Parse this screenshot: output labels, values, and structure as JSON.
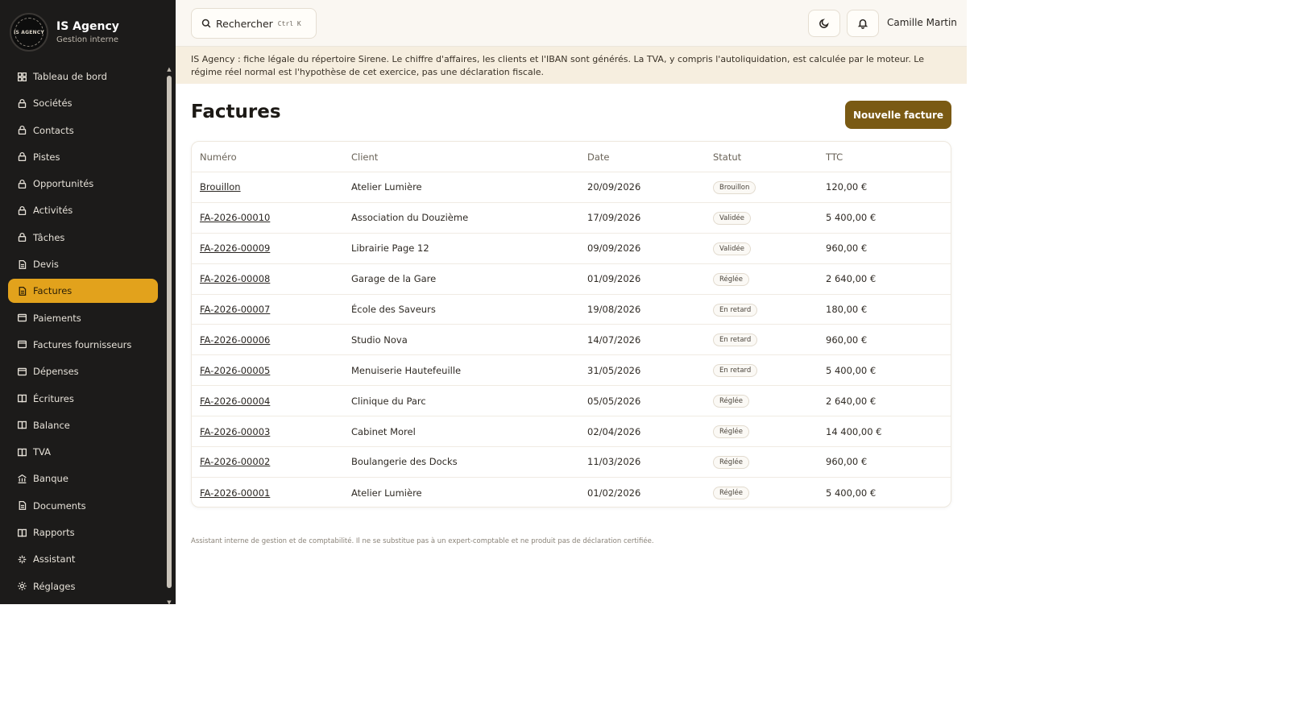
{
  "brand": {
    "logo_text": "IS AGENCY",
    "name": "IS Agency",
    "subtitle": "Gestion interne"
  },
  "sidebar": {
    "items": [
      {
        "label": "Tableau de bord",
        "icon": "dashboard-icon",
        "active": false
      },
      {
        "label": "Sociétés",
        "icon": "lock-icon",
        "active": false
      },
      {
        "label": "Contacts",
        "icon": "lock-icon",
        "active": false
      },
      {
        "label": "Pistes",
        "icon": "lock-icon",
        "active": false
      },
      {
        "label": "Opportunités",
        "icon": "lock-icon",
        "active": false
      },
      {
        "label": "Activités",
        "icon": "lock-icon",
        "active": false
      },
      {
        "label": "Tâches",
        "icon": "lock-icon",
        "active": false
      },
      {
        "label": "Devis",
        "icon": "file-icon",
        "active": false
      },
      {
        "label": "Factures",
        "icon": "file-icon",
        "active": true
      },
      {
        "label": "Paiements",
        "icon": "card-icon",
        "active": false
      },
      {
        "label": "Factures fournisseurs",
        "icon": "card-icon",
        "active": false
      },
      {
        "label": "Dépenses",
        "icon": "card-icon",
        "active": false
      },
      {
        "label": "Écritures",
        "icon": "book-icon",
        "active": false
      },
      {
        "label": "Balance",
        "icon": "book-icon",
        "active": false
      },
      {
        "label": "TVA",
        "icon": "book-icon",
        "active": false
      },
      {
        "label": "Banque",
        "icon": "bank-icon",
        "active": false
      },
      {
        "label": "Documents",
        "icon": "file-icon",
        "active": false
      },
      {
        "label": "Rapports",
        "icon": "book-icon",
        "active": false
      },
      {
        "label": "Assistant",
        "icon": "sparkle-icon",
        "active": false
      },
      {
        "label": "Réglages",
        "icon": "gear-icon",
        "active": false
      }
    ]
  },
  "topbar": {
    "search_label": "Rechercher",
    "search_shortcut": "Ctrl K",
    "user_name": "Camille Martin"
  },
  "banner": {
    "text": "IS Agency : fiche légale du répertoire Sirene. Le chiffre d'affaires, les clients et l'IBAN sont générés. La TVA, y compris l'autoliquidation, est calculée par le moteur. Le régime réel normal est l'hypothèse de cet exercice, pas une déclaration fiscale."
  },
  "main": {
    "title": "Factures",
    "new_button": "Nouvelle facture",
    "columns": [
      "Numéro",
      "Client",
      "Date",
      "Statut",
      "TTC"
    ],
    "rows": [
      {
        "number": "Brouillon",
        "client": "Atelier Lumière",
        "date": "20/09/2026",
        "status": "Brouillon",
        "ttc": "120,00 €"
      },
      {
        "number": "FA-2026-00010",
        "client": "Association du Douzième",
        "date": "17/09/2026",
        "status": "Validée",
        "ttc": "5 400,00 €"
      },
      {
        "number": "FA-2026-00009",
        "client": "Librairie Page 12",
        "date": "09/09/2026",
        "status": "Validée",
        "ttc": "960,00 €"
      },
      {
        "number": "FA-2026-00008",
        "client": "Garage de la Gare",
        "date": "01/09/2026",
        "status": "Réglée",
        "ttc": "2 640,00 €"
      },
      {
        "number": "FA-2026-00007",
        "client": "École des Saveurs",
        "date": "19/08/2026",
        "status": "En retard",
        "ttc": "180,00 €"
      },
      {
        "number": "FA-2026-00006",
        "client": "Studio Nova",
        "date": "14/07/2026",
        "status": "En retard",
        "ttc": "960,00 €"
      },
      {
        "number": "FA-2026-00005",
        "client": "Menuiserie Hautefeuille",
        "date": "31/05/2026",
        "status": "En retard",
        "ttc": "5 400,00 €"
      },
      {
        "number": "FA-2026-00004",
        "client": "Clinique du Parc",
        "date": "05/05/2026",
        "status": "Réglée",
        "ttc": "2 640,00 €"
      },
      {
        "number": "FA-2026-00003",
        "client": "Cabinet Morel",
        "date": "02/04/2026",
        "status": "Réglée",
        "ttc": "14 400,00 €"
      },
      {
        "number": "FA-2026-00002",
        "client": "Boulangerie des Docks",
        "date": "11/03/2026",
        "status": "Réglée",
        "ttc": "960,00 €"
      },
      {
        "number": "FA-2026-00001",
        "client": "Atelier Lumière",
        "date": "01/02/2026",
        "status": "Réglée",
        "ttc": "5 400,00 €"
      }
    ]
  },
  "footer": {
    "note": "Assistant interne de gestion et de comptabilité. Il ne se substitue pas à un expert-comptable et ne produit pas de déclaration certifiée."
  },
  "colors": {
    "sidebar_bg": "#1c1b1a",
    "active_item": "#e2a21c",
    "primary_button": "#7a5a14",
    "banner_bg": "#f6eedf"
  }
}
